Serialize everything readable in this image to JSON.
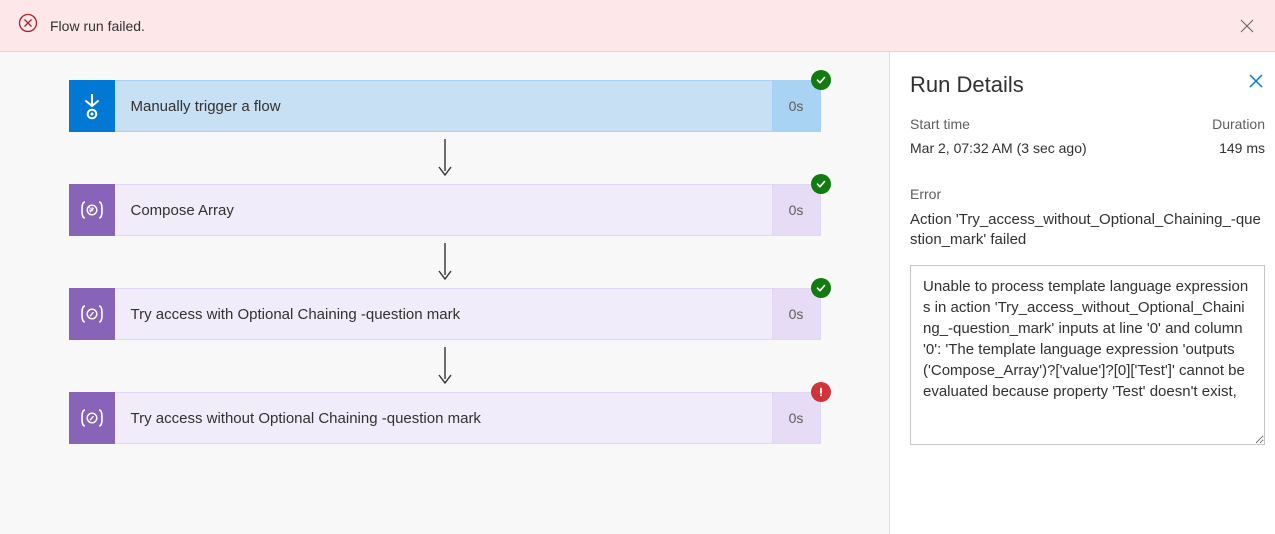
{
  "banner": {
    "message": "Flow run failed."
  },
  "steps": [
    {
      "kind": "trigger",
      "label": "Manually trigger a flow",
      "time": "0s",
      "status": "success"
    },
    {
      "kind": "compose",
      "label": "Compose Array",
      "time": "0s",
      "status": "success"
    },
    {
      "kind": "compose",
      "label": "Try access with Optional Chaining -question mark",
      "time": "0s",
      "status": "success"
    },
    {
      "kind": "compose",
      "label": "Try access without Optional Chaining -question mark",
      "time": "0s",
      "status": "error"
    }
  ],
  "details": {
    "title": "Run Details",
    "startTimeLabel": "Start time",
    "startTime": "Mar 2, 07:32 AM (3 sec ago)",
    "durationLabel": "Duration",
    "duration": "149 ms",
    "errorLabel": "Error",
    "errorTitle": "Action 'Try_access_without_Optional_Chaining_-question_mark' failed",
    "errorBody": "Unable to process template language expressions in action 'Try_access_without_Optional_Chaining_-question_mark' inputs at line '0' and column '0': 'The template language expression 'outputs('Compose_Array')?['value']?[0]['Test']' cannot be evaluated because property 'Test' doesn't exist,"
  }
}
